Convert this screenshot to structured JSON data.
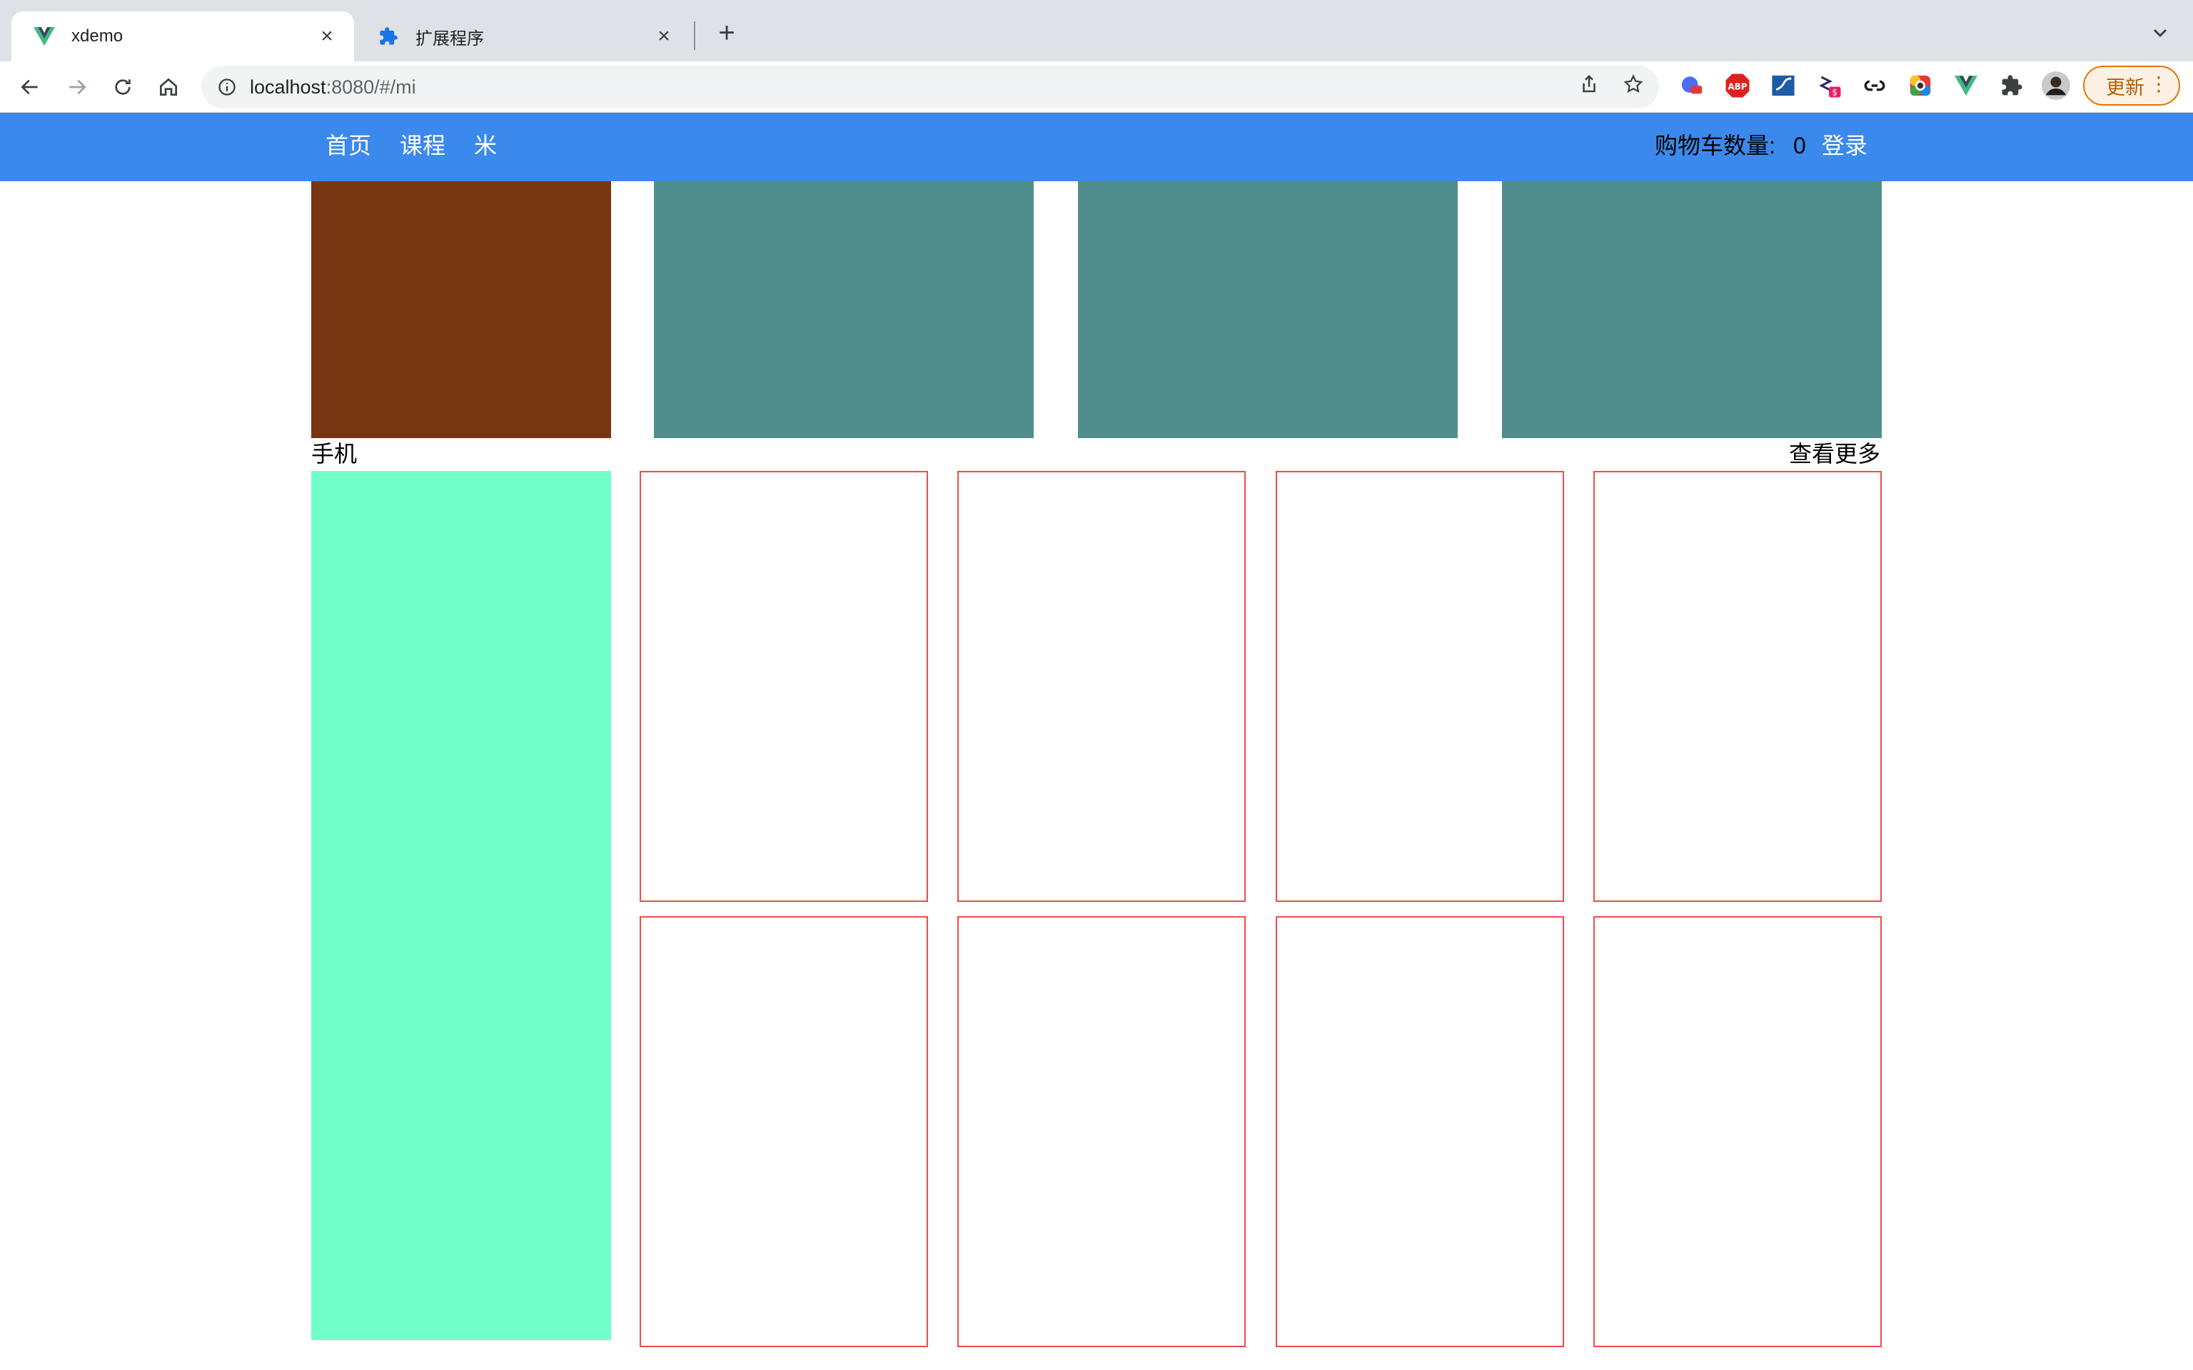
{
  "browser": {
    "tabs": [
      {
        "title": "xdemo",
        "icon": "vue-logo-icon",
        "active": true
      },
      {
        "title": "扩展程序",
        "icon": "puzzle-piece-icon",
        "active": false
      }
    ],
    "url_host": "localhost",
    "url_path": ":8080/#/mi",
    "update_label": "更新",
    "colors": {
      "tabstrip": "#dee1e6",
      "update_border": "#e37400"
    }
  },
  "nav": {
    "links": [
      "首页",
      "课程",
      "米"
    ],
    "cart_label": "购物车数量:",
    "cart_count": "0",
    "login_label": "登录"
  },
  "section": {
    "title": "手机",
    "more_label": "查看更多"
  },
  "colors": {
    "nav_bg": "#3b89ec",
    "banner_primary": "#783511",
    "banner_secondary": "#508e8e",
    "sidebar_block": "#71ffc9",
    "card_border": "#f44a4a"
  }
}
